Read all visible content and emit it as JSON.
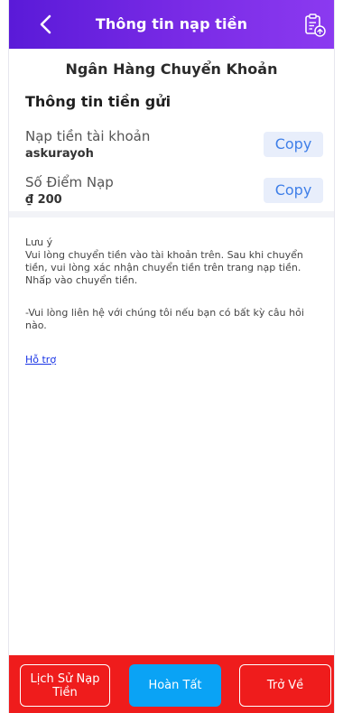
{
  "header": {
    "title": "Thông tin nạp tiền",
    "back_icon": "chevron-left-icon",
    "history_icon": "clipboard-upload-icon",
    "gradient_colors": [
      "#5a1ad8",
      "#8b3af0"
    ]
  },
  "bank": {
    "name": "Ngân Hàng Chuyển Khoản"
  },
  "deposit_info": {
    "section_title": "Thông tin tiền gửi",
    "rows": [
      {
        "label": "Nạp tiền tài khoản",
        "value": "askurayoh",
        "copy_label": "Copy"
      },
      {
        "label": "Số Điểm Nạp",
        "value": "₫ 200",
        "copy_label": "Copy"
      }
    ]
  },
  "notes": {
    "heading": "Lưu ý",
    "line1": "Vui lòng chuyển tiền vào tài khoản trên. Sau khi chuyển tiền, vui lòng xác nhận chuyển tiền trên trang nạp tiền. Nhấp vào chuyển tiền.",
    "line2": "-Vui lòng liên hệ với chúng tôi nếu bạn có bất kỳ câu hỏi nào.",
    "support_link": "Hỗ trợ"
  },
  "footer": {
    "history_label": "Lịch Sử Nạp Tiền",
    "complete_label": "Hoàn Tất",
    "back_label": "Trở Về",
    "bg_color": "#ef1c1c",
    "primary_color": "#0aa3f5"
  }
}
